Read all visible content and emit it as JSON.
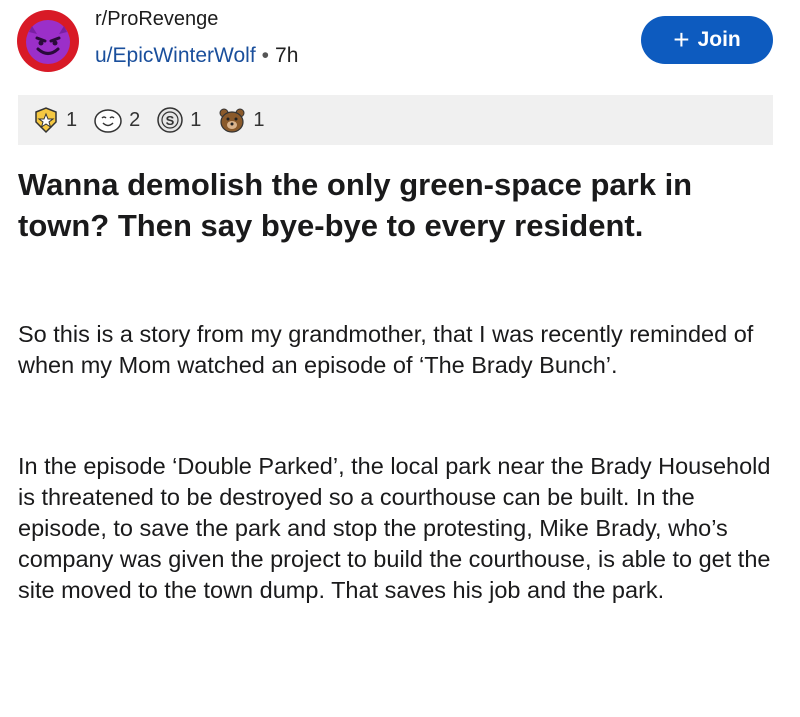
{
  "header": {
    "subreddit": "r/ProRevenge",
    "username": "u/EpicWinterWolf",
    "separator": "•",
    "time": "7h",
    "join_label": "Join",
    "join_icon": "plus-icon"
  },
  "awards": [
    {
      "icon": "star-award-icon",
      "count": "1"
    },
    {
      "icon": "wholesome-award-icon",
      "count": "2"
    },
    {
      "icon": "silver-award-icon",
      "count": "1"
    },
    {
      "icon": "bear-award-icon",
      "count": "1"
    }
  ],
  "post": {
    "title": "Wanna demolish the only green-space park in town? Then say bye-bye to every resident.",
    "paragraphs": [
      "So this is a story from my grandmother, that I was recently reminded of when my Mom watched an episode of ‘The Brady Bunch’.",
      "In the episode ‘Double Parked’, the local park near the Brady Household is threatened to be destroyed so a courthouse can be built. In the episode, to save the park and stop the protesting, Mike Brady, who’s company was given the project to build the courthouse, is able to get the site moved to the town dump. That saves his job and the park."
    ]
  },
  "colors": {
    "join_button": "#0d5bbf",
    "username": "#1a4f9c",
    "avatar_ring": "#d81a26",
    "avatar_face": "#9b2fc9",
    "awards_bar": "#f0f0f0"
  }
}
